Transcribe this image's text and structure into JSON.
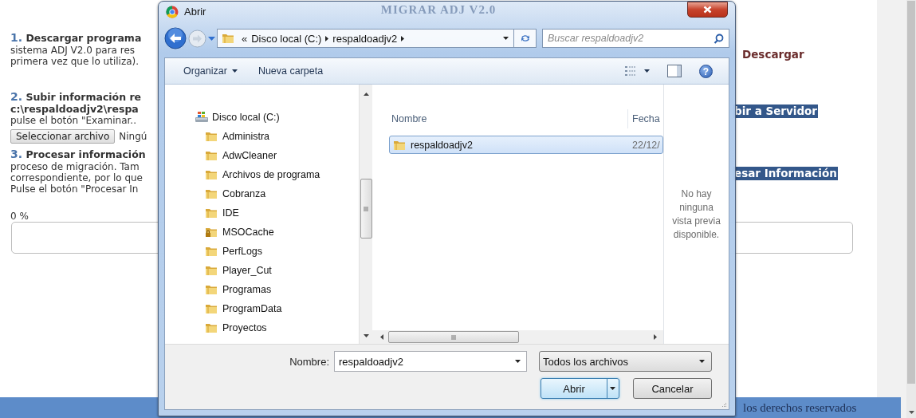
{
  "page": {
    "title": "MIGRAR ADJ V2.0",
    "left_lines": [
      {
        "kind": "heading",
        "number": "1.",
        "text": "Descargar programa"
      },
      {
        "kind": "text",
        "text": "sistema ADJ V2.0 para res"
      },
      {
        "kind": "text",
        "text": "primera vez que lo utiliza)."
      },
      {
        "kind": "heading",
        "number": "2.",
        "text": "Subir información re"
      },
      {
        "kind": "path",
        "text": "c:\\respaldoadjv2\\respa"
      },
      {
        "kind": "text",
        "text": "pulse el botón \"Examinar.."
      },
      {
        "kind": "file",
        "button": "Seleccionar archivo",
        "status": "Ningú"
      },
      {
        "kind": "heading",
        "number": "3.",
        "text": "Procesar información"
      },
      {
        "kind": "text",
        "text": "proceso de migración. Tam"
      },
      {
        "kind": "text",
        "text": "correspondiente, por lo que"
      },
      {
        "kind": "text",
        "text": "Pulse el botón \"Procesar In"
      },
      {
        "kind": "reading",
        "text": "0 %"
      }
    ],
    "progress": {
      "level": 0
    },
    "actions": [
      {
        "label": "Descargar",
        "highlighted": false
      },
      {
        "label": "bir a Servidor",
        "highlighted": true
      },
      {
        "label": "esar Información",
        "highlighted": true
      }
    ],
    "footer": "los derechos reservados"
  },
  "dialog": {
    "title": "Abrir",
    "breadcrumb": {
      "overflow": "«",
      "segments": [
        "Disco local (C:)",
        "respaldoadjv2"
      ]
    },
    "search": {
      "placeholder": "Buscar respaldoadjv2"
    },
    "toolbar": [
      {
        "label": "Organizar",
        "menu": true
      },
      {
        "label": "Nueva carpeta",
        "menu": false
      }
    ],
    "help": "?",
    "tree": [
      {
        "label": "Disco local (C:)",
        "kind": "drive",
        "children": [
          {
            "label": "Administra",
            "kind": "folder"
          },
          {
            "label": "AdwCleaner",
            "kind": "folder"
          },
          {
            "label": "Archivos de programa",
            "kind": "folder"
          },
          {
            "label": "Cobranza",
            "kind": "folder"
          },
          {
            "label": "IDE",
            "kind": "folder"
          },
          {
            "label": "MSOCache",
            "kind": "locked"
          },
          {
            "label": "PerfLogs",
            "kind": "folder"
          },
          {
            "label": "Player_Cut",
            "kind": "folder"
          },
          {
            "label": "Programas",
            "kind": "folder"
          },
          {
            "label": "ProgramData",
            "kind": "folder"
          },
          {
            "label": "Proyectos",
            "kind": "folder"
          }
        ]
      }
    ],
    "files": {
      "columns": [
        "Nombre",
        "Fecha"
      ],
      "rows": [
        {
          "name": "respaldoadjv2",
          "date": "22/12/",
          "selected": true
        }
      ]
    },
    "preview": "No hay ninguna vista previa disponible.",
    "filename": {
      "label": "Nombre:",
      "value": "respaldoadjv2"
    },
    "filter": "Todos los archivos",
    "buttons": [
      {
        "label": "Abrir",
        "kind": "split"
      },
      {
        "label": "Cancelar",
        "kind": "plain"
      }
    ]
  }
}
